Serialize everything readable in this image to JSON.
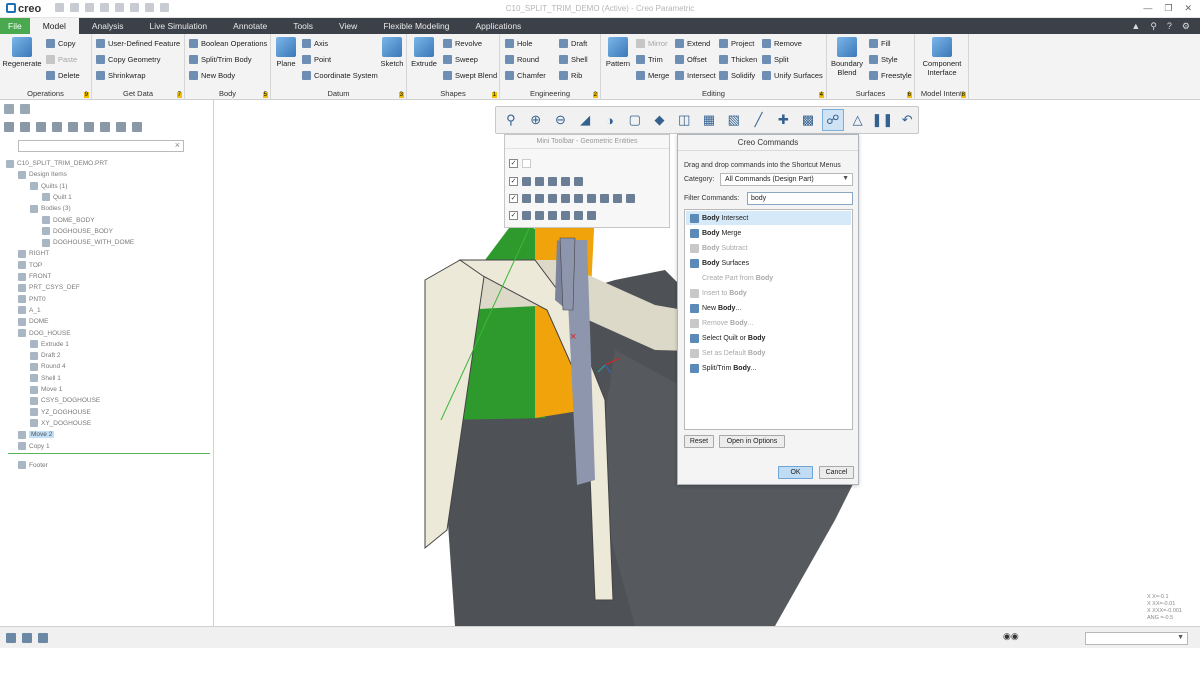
{
  "app": {
    "logo": "creo",
    "window_title": "C10_SPLIT_TRIM_DEMO (Active) - Creo Parametric"
  },
  "menu": {
    "tabs": [
      "File",
      "Model",
      "Analysis",
      "Live Simulation",
      "Annotate",
      "Tools",
      "View",
      "Flexible Modeling",
      "Applications"
    ]
  },
  "ribbon": {
    "operations": {
      "label": "Operations",
      "num": "9",
      "regenerate": "Regenerate",
      "copy": "Copy",
      "paste": "Paste",
      "delete": "Delete"
    },
    "get_data": {
      "label": "Get Data",
      "num": "7",
      "udf": "User-Defined Feature",
      "copy_geom": "Copy Geometry",
      "shrinkwrap": "Shrinkwrap"
    },
    "body": {
      "label": "Body",
      "num": "5",
      "boolean": "Boolean Operations",
      "split_trim": "Split/Trim Body",
      "new_body": "New Body"
    },
    "datum": {
      "label": "Datum",
      "num": "3",
      "plane": "Plane",
      "axis": "Axis",
      "point": "Point",
      "csys": "Coordinate System",
      "sketch": "Sketch"
    },
    "shapes": {
      "label": "Shapes",
      "num": "1",
      "extrude": "Extrude",
      "revolve": "Revolve",
      "sweep": "Sweep",
      "swept_blend": "Swept Blend"
    },
    "engineering": {
      "label": "Engineering",
      "num": "2",
      "hole": "Hole",
      "round": "Round",
      "chamfer": "Chamfer",
      "draft": "Draft",
      "shell": "Shell",
      "rib": "Rib"
    },
    "editing": {
      "label": "Editing",
      "num": "4",
      "pattern": "Pattern",
      "mirror": "Mirror",
      "trim": "Trim",
      "merge": "Merge",
      "extend": "Extend",
      "offset": "Offset",
      "intersect": "Intersect",
      "project": "Project",
      "thicken": "Thicken",
      "solidify": "Solidify",
      "remove": "Remove",
      "split": "Split",
      "unify": "Unify Surfaces"
    },
    "surfaces": {
      "label": "Surfaces",
      "num": "6",
      "boundary": "Boundary Blend",
      "fill": "Fill",
      "style": "Style",
      "freestyle": "Freestyle"
    },
    "model_intent": {
      "label": "Model Intent",
      "num": "8",
      "component": "Component Interface"
    }
  },
  "tree": {
    "items": [
      {
        "label": "C10_SPLIT_TRIM_DEMO.PRT",
        "indent": 0
      },
      {
        "label": "Design Items",
        "indent": 1
      },
      {
        "label": "Quilts (1)",
        "indent": 2
      },
      {
        "label": "Quilt 1",
        "indent": 3
      },
      {
        "label": "Bodies (3)",
        "indent": 2
      },
      {
        "label": "DOME_BODY",
        "indent": 3
      },
      {
        "label": "DOGHOUSE_BODY",
        "indent": 3
      },
      {
        "label": "DOGHOUSE_WITH_DOME",
        "indent": 3
      },
      {
        "label": "RIGHT",
        "indent": 1
      },
      {
        "label": "TOP",
        "indent": 1
      },
      {
        "label": "FRONT",
        "indent": 1
      },
      {
        "label": "PRT_CSYS_DEF",
        "indent": 1
      },
      {
        "label": "PNT0",
        "indent": 1
      },
      {
        "label": "A_1",
        "indent": 1
      },
      {
        "label": "DOME",
        "indent": 1
      },
      {
        "label": "DOG_HOUSE",
        "indent": 1
      },
      {
        "label": "Extrude 1",
        "indent": 2
      },
      {
        "label": "Draft 2",
        "indent": 2
      },
      {
        "label": "Round 4",
        "indent": 2
      },
      {
        "label": "Shell 1",
        "indent": 2
      },
      {
        "label": "Move 1",
        "indent": 2
      },
      {
        "label": "CSYS_DOGHOUSE",
        "indent": 2
      },
      {
        "label": "YZ_DOGHOUSE",
        "indent": 2
      },
      {
        "label": "XY_DOGHOUSE",
        "indent": 2
      },
      {
        "label": "Move 2",
        "indent": 1,
        "selected": true
      },
      {
        "label": "Copy 1",
        "indent": 1
      },
      {
        "label": "Footer",
        "indent": 1,
        "gap": true
      }
    ]
  },
  "mini_toolbar": {
    "title": "Mini Toolbar - Geometric Entities"
  },
  "dialog": {
    "title": "Creo Commands",
    "instructions": "Drag and drop commands into the Shortcut Menus",
    "category_label": "Category:",
    "category_value": "All Commands (Design Part)",
    "filter_label": "Filter Commands:",
    "filter_value": "body",
    "commands": [
      {
        "pre": "",
        "b": "Body",
        "post": " Intersect",
        "dim": false,
        "hl": true
      },
      {
        "pre": "",
        "b": "Body",
        "post": " Merge",
        "dim": false
      },
      {
        "pre": "",
        "b": "Body",
        "post": " Subtract",
        "dim": true
      },
      {
        "pre": "",
        "b": "Body",
        "post": " Surfaces",
        "dim": false
      },
      {
        "pre": "Create Part from ",
        "b": "Body",
        "post": "",
        "dim": true,
        "noicon": true
      },
      {
        "pre": "Insert to ",
        "b": "Body",
        "post": "",
        "dim": true
      },
      {
        "pre": "New ",
        "b": "Body",
        "post": "...",
        "dim": false
      },
      {
        "pre": "Remove ",
        "b": "Body",
        "post": "...",
        "dim": true
      },
      {
        "pre": "Select Quilt or ",
        "b": "Body",
        "post": "",
        "dim": false
      },
      {
        "pre": "Set as Default ",
        "b": "Body",
        "post": "",
        "dim": true
      },
      {
        "pre": "Split/Trim ",
        "b": "Body",
        "post": "...",
        "dim": false
      }
    ],
    "reset": "Reset",
    "open_options": "Open in Options",
    "ok": "OK",
    "cancel": "Cancel"
  },
  "viewport": {
    "coord_readout": [
      "X X=-0.1",
      "X XX=-0.01",
      "X XXX=-0.001",
      "ANG =-0.5"
    ]
  },
  "colors": {
    "file_tab": "#4aa84e",
    "tabbar": "#3c4049",
    "green_face": "#2e9a2e",
    "orange_face": "#f0a30a"
  }
}
